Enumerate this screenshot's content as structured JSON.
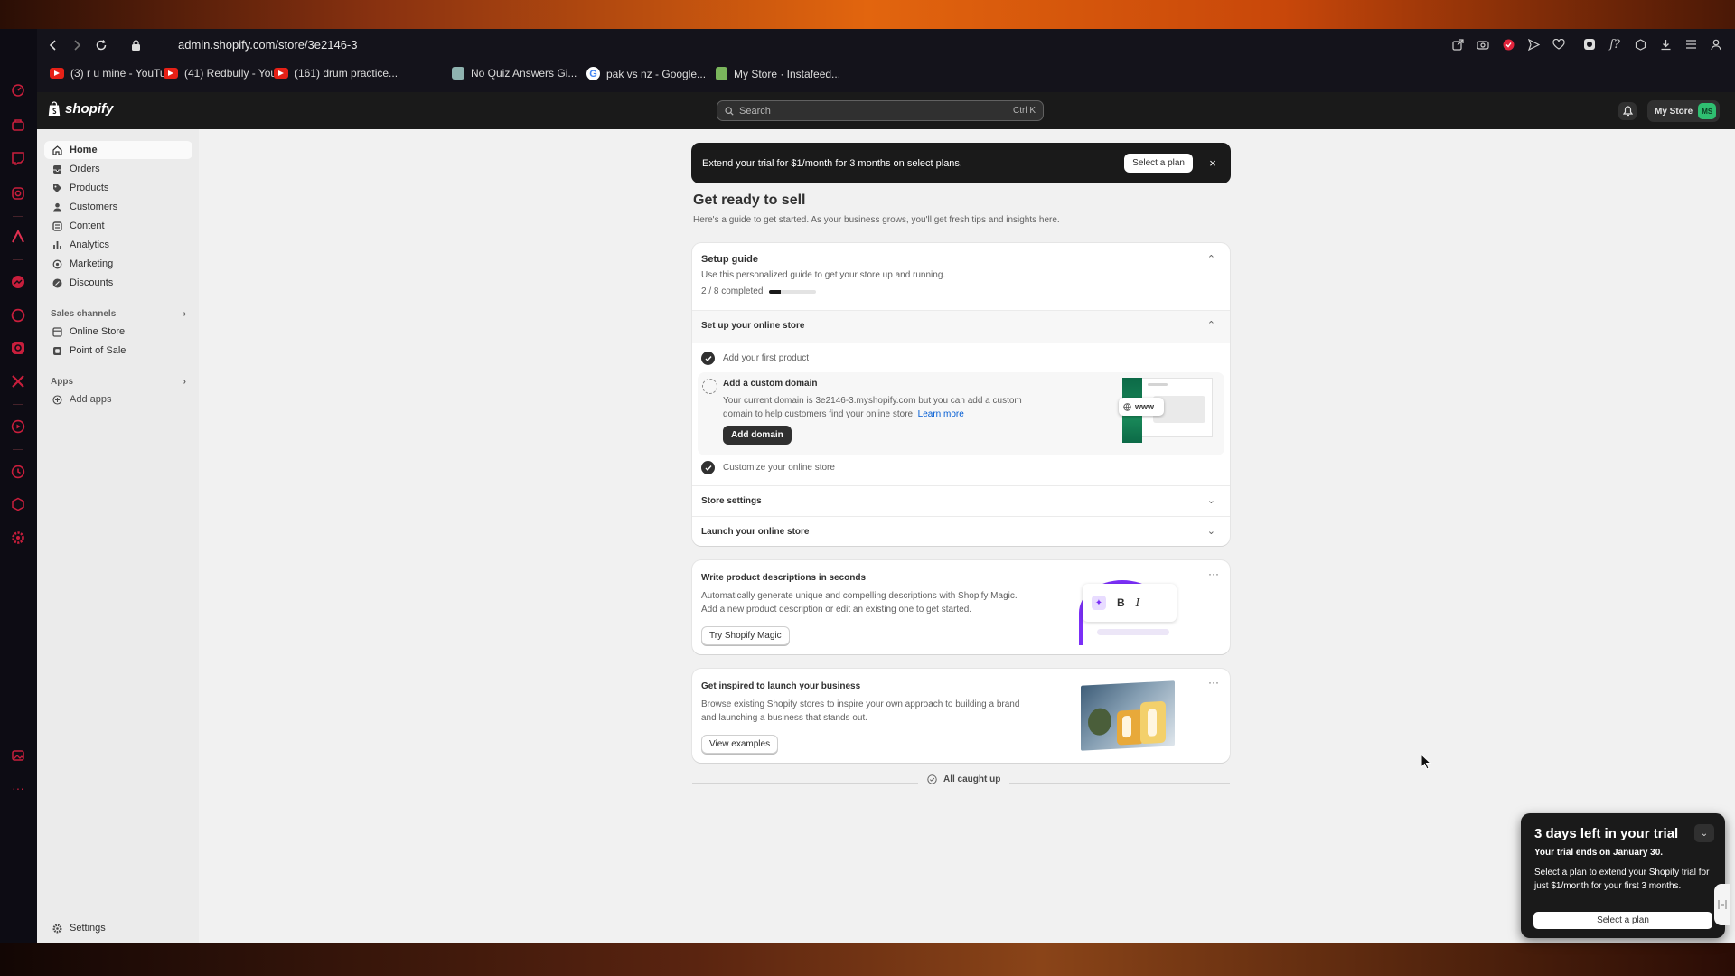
{
  "browser": {
    "url": "admin.shopify.com/store/3e2146-3",
    "bookmarks": [
      {
        "label": "(3) r u mine - YouTu...",
        "icon": "youtube-icon"
      },
      {
        "label": "(41) Redbully - You...",
        "icon": "youtube-icon"
      },
      {
        "label": "(161) drum practice...",
        "icon": "youtube-icon"
      },
      {
        "label": "No Quiz Answers Gi...",
        "icon": "quiz-icon"
      },
      {
        "label": "pak vs nz - Google...",
        "icon": "google-icon"
      },
      {
        "label": "My Store · Instafeed...",
        "icon": "shopify-icon"
      }
    ]
  },
  "topbar": {
    "brand": "shopify",
    "search_placeholder": "Search",
    "search_shortcut": "Ctrl K",
    "store_name": "My Store",
    "avatar_initials": "MS"
  },
  "sidebar": {
    "items": [
      {
        "label": "Home",
        "icon": "home-icon"
      },
      {
        "label": "Orders",
        "icon": "orders-icon"
      },
      {
        "label": "Products",
        "icon": "tag-icon"
      },
      {
        "label": "Customers",
        "icon": "person-icon"
      },
      {
        "label": "Content",
        "icon": "content-icon"
      },
      {
        "label": "Analytics",
        "icon": "bar-chart-icon"
      },
      {
        "label": "Marketing",
        "icon": "target-icon"
      },
      {
        "label": "Discounts",
        "icon": "discount-icon"
      }
    ],
    "sales_channels_label": "Sales channels",
    "channels": [
      {
        "label": "Online Store",
        "icon": "store-icon"
      },
      {
        "label": "Point of Sale",
        "icon": "pos-icon"
      }
    ],
    "apps_label": "Apps",
    "add_apps": "Add apps",
    "settings": "Settings"
  },
  "banner": {
    "text": "Extend your trial for $1/month for 3 months on select plans.",
    "button": "Select a plan",
    "close": "×"
  },
  "page": {
    "title": "Get ready to sell",
    "subtitle": "Here's a guide to get started. As your business grows, you'll get fresh tips and insights here."
  },
  "setup_guide": {
    "title": "Setup guide",
    "description": "Use this personalized guide to get your store up and running.",
    "progress_text": "2 / 8 completed",
    "progress_fraction": 0.25,
    "section_title": "Set up your online store",
    "tasks": {
      "first_product": "Add your first product",
      "custom_domain_title": "Add a custom domain",
      "custom_domain_desc_line1": "Your current domain is 3e2146-3.myshopify.com but you can add a custom",
      "custom_domain_desc_line2": "domain to help customers find your online store.",
      "learn_more": "Learn more",
      "add_domain": "Add domain",
      "customize": "Customize your online store"
    },
    "illustration_text": "www",
    "store_settings": "Store settings",
    "launch": "Launch your online store"
  },
  "magic_card": {
    "title": "Write product descriptions in seconds",
    "line1": "Automatically generate unique and compelling descriptions with Shopify Magic.",
    "line2": "Add a new product description or edit an existing one to get started.",
    "button": "Try Shopify Magic",
    "bold_glyph": "B",
    "italic_glyph": "I"
  },
  "inspire_card": {
    "title": "Get inspired to launch your business",
    "line1": "Browse existing Shopify stores to inspire your own approach to building a brand",
    "line2": "and launching a business that stands out.",
    "button": "View examples"
  },
  "footer_status": "All caught up",
  "trial_toast": {
    "title": "3 days left in your trial",
    "ends_prefix": "Your trial ends on ",
    "ends_date": "January 30.",
    "body": "Select a plan to extend your Shopify trial for just $1/month for your first 3 months.",
    "button": "Select a plan"
  },
  "colors": {
    "accent_green": "#2fbf71",
    "dark": "#1a1a1a",
    "link": "#005bd3"
  }
}
